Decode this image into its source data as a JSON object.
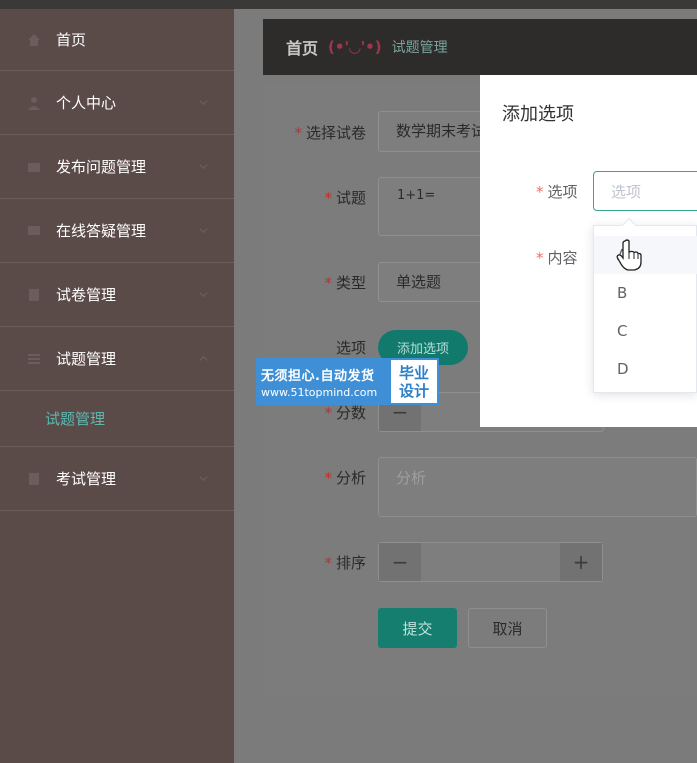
{
  "sidebar": {
    "items": [
      {
        "label": "首页",
        "icon": "home-icon"
      },
      {
        "label": "个人中心",
        "icon": "user-icon"
      },
      {
        "label": "发布问题管理",
        "icon": "folder-icon"
      },
      {
        "label": "在线答疑管理",
        "icon": "chat-icon"
      },
      {
        "label": "试卷管理",
        "icon": "paper-icon"
      },
      {
        "label": "试题管理",
        "icon": "list-icon"
      },
      {
        "label": "考试管理",
        "icon": "exam-icon"
      }
    ],
    "sub_item": "试题管理"
  },
  "header": {
    "home": "首页",
    "face": "(•'◡'•)",
    "crumb": "试题管理"
  },
  "form": {
    "paper_label": "选择试卷",
    "paper_value": "数学期末考试",
    "question_label": "试题",
    "question_value": "1+1=",
    "type_label": "类型",
    "type_value": "单选题",
    "options_label": "选项",
    "add_option_button": "添加选项",
    "score_label": "分数",
    "score_minus": "−",
    "analysis_label": "分析",
    "analysis_placeholder": "分析",
    "order_label": "排序",
    "order_minus": "−",
    "order_plus": "+",
    "submit": "提交",
    "cancel": "取消"
  },
  "watermark": {
    "line1": "无须担心.自动发货",
    "line2": "www.51topmind.com",
    "badge1": "毕业",
    "badge2": "设计"
  },
  "dialog": {
    "title": "添加选项",
    "option_label": "选项",
    "option_placeholder": "选项",
    "content_label": "内容",
    "dropdown_options": [
      "A",
      "B",
      "C",
      "D"
    ]
  },
  "colors": {
    "accent": "#3aa394",
    "required": "#f56c6c"
  }
}
